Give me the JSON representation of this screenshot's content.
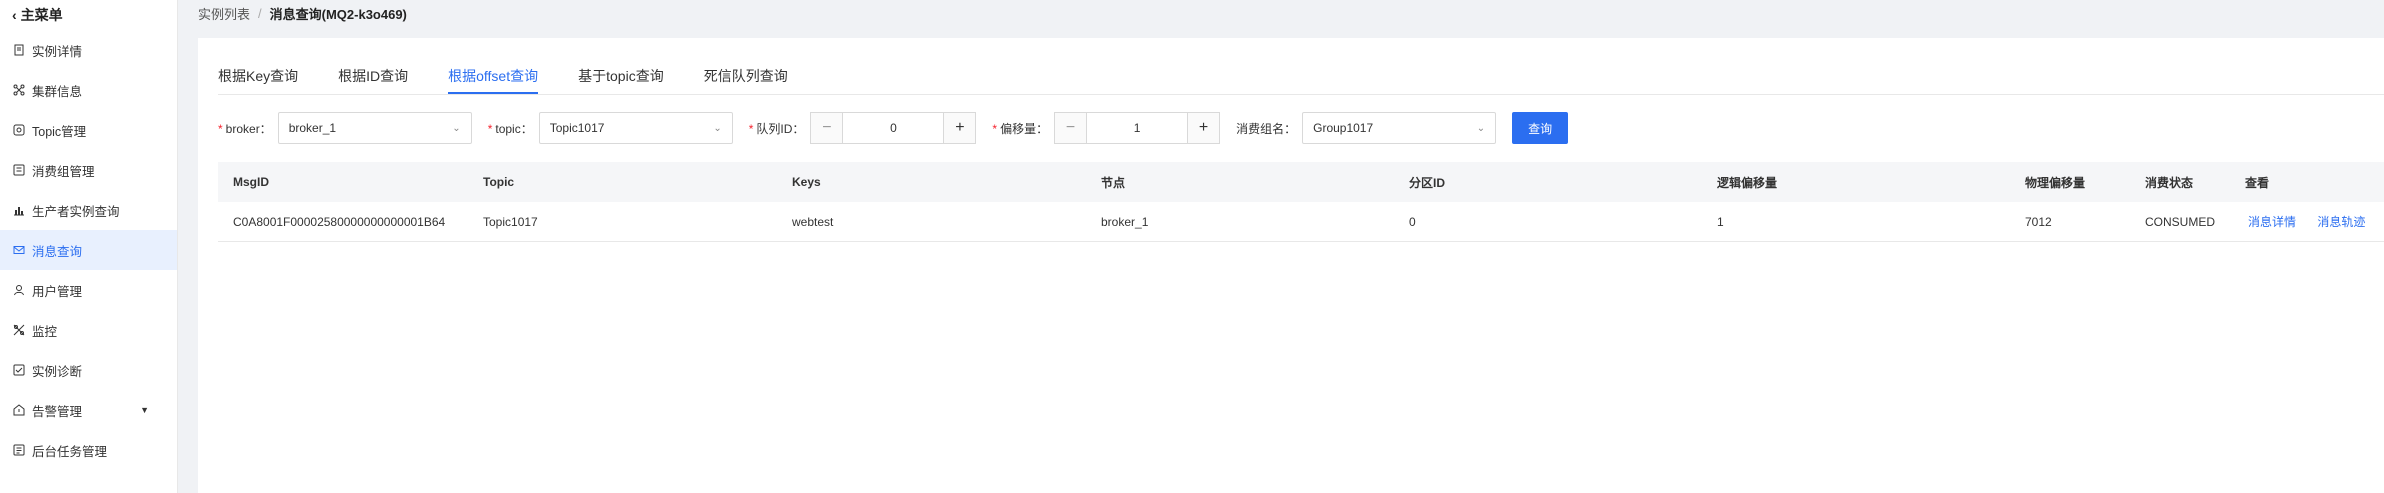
{
  "sidebar": {
    "back_label": "主菜单",
    "items": [
      {
        "label": "实例详情",
        "icon": "file-icon"
      },
      {
        "label": "集群信息",
        "icon": "cluster-icon"
      },
      {
        "label": "Topic管理",
        "icon": "topic-icon"
      },
      {
        "label": "消费组管理",
        "icon": "consumer-group-icon"
      },
      {
        "label": "生产者实例查询",
        "icon": "chart-icon"
      },
      {
        "label": "消息查询",
        "icon": "mail-icon",
        "active": true
      },
      {
        "label": "用户管理",
        "icon": "user-icon"
      },
      {
        "label": "监控",
        "icon": "monitor-icon"
      },
      {
        "label": "实例诊断",
        "icon": "diagnose-icon"
      },
      {
        "label": "告警管理",
        "icon": "alarm-icon",
        "has_caret": true
      },
      {
        "label": "后台任务管理",
        "icon": "task-icon"
      }
    ]
  },
  "breadcrumb": {
    "parent": "实例列表",
    "separator": "/",
    "current": "消息查询(MQ2-k3o469)"
  },
  "tabs": [
    {
      "label": "根据Key查询"
    },
    {
      "label": "根据ID查询"
    },
    {
      "label": "根据offset查询",
      "active": true
    },
    {
      "label": "基于topic查询"
    },
    {
      "label": "死信队列查询"
    }
  ],
  "filters": {
    "broker_label": "broker：",
    "broker_value": "broker_1",
    "topic_label": "topic：",
    "topic_value": "Topic1017",
    "queue_label": "队列ID：",
    "queue_value": "0",
    "offset_label": "偏移量：",
    "offset_value": "1",
    "group_label": "消费组名：",
    "group_value": "Group1017",
    "query_label": "查询",
    "required_mark": "*"
  },
  "table": {
    "headers": [
      "MsgID",
      "Topic",
      "Keys",
      "节点",
      "分区ID",
      "逻辑偏移量",
      "物理偏移量",
      "消费状态",
      "查看"
    ],
    "rows": [
      {
        "msgid": "C0A8001F00002580000000000001B64",
        "topic": "Topic1017",
        "keys": "webtest",
        "node": "broker_1",
        "partition": "0",
        "logical_offset": "1",
        "physical_offset": "7012",
        "status": "CONSUMED",
        "link_detail": "消息详情",
        "link_trace": "消息轨迹"
      }
    ]
  },
  "colors": {
    "accent": "#2b6ef0",
    "required": "#f5222d"
  }
}
